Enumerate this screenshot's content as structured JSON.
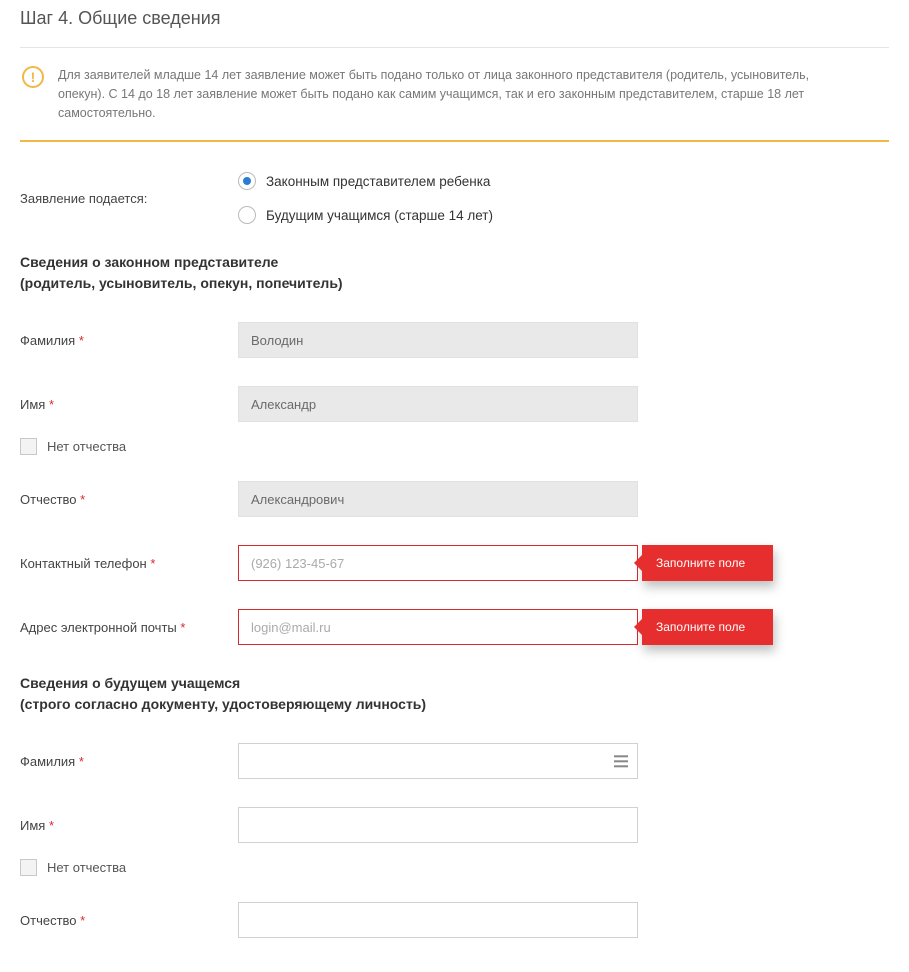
{
  "step_title": "Шаг 4. Общие сведения",
  "notice": "Для заявителей младше 14 лет заявление может быть подано только от лица законного представителя (родитель, усыновитель, опекун). С 14 до 18 лет заявление может быть подано как самим учащимся, так и его законным представителем, старше 18 лет самостоятельно.",
  "submit_label": "Заявление подается:",
  "radio": {
    "legal_rep": "Законным представителем ребенка",
    "student": "Будущим учащимся (старше 14 лет)"
  },
  "rep_section": {
    "line1": "Сведения о законном представителе",
    "line2": "(родитель, усыновитель, опекун, попечитель)",
    "lastname_lbl": "Фамилия",
    "lastname_val": "Володин",
    "firstname_lbl": "Имя",
    "firstname_val": "Александр",
    "no_patronymic": "Нет отчества",
    "patronymic_lbl": "Отчество",
    "patronymic_val": "Александрович",
    "phone_lbl": "Контактный телефон",
    "phone_ph": "(926) 123-45-67",
    "email_lbl": "Адрес электронной почты",
    "email_ph": "login@mail.ru"
  },
  "error_text": "Заполните поле",
  "student_section": {
    "line1": "Сведения о будущем учащемся",
    "line2": "(строго согласно документу, удостоверяющему личность)",
    "lastname_lbl": "Фамилия",
    "firstname_lbl": "Имя",
    "no_patronymic": "Нет отчества",
    "patronymic_lbl": "Отчество"
  }
}
